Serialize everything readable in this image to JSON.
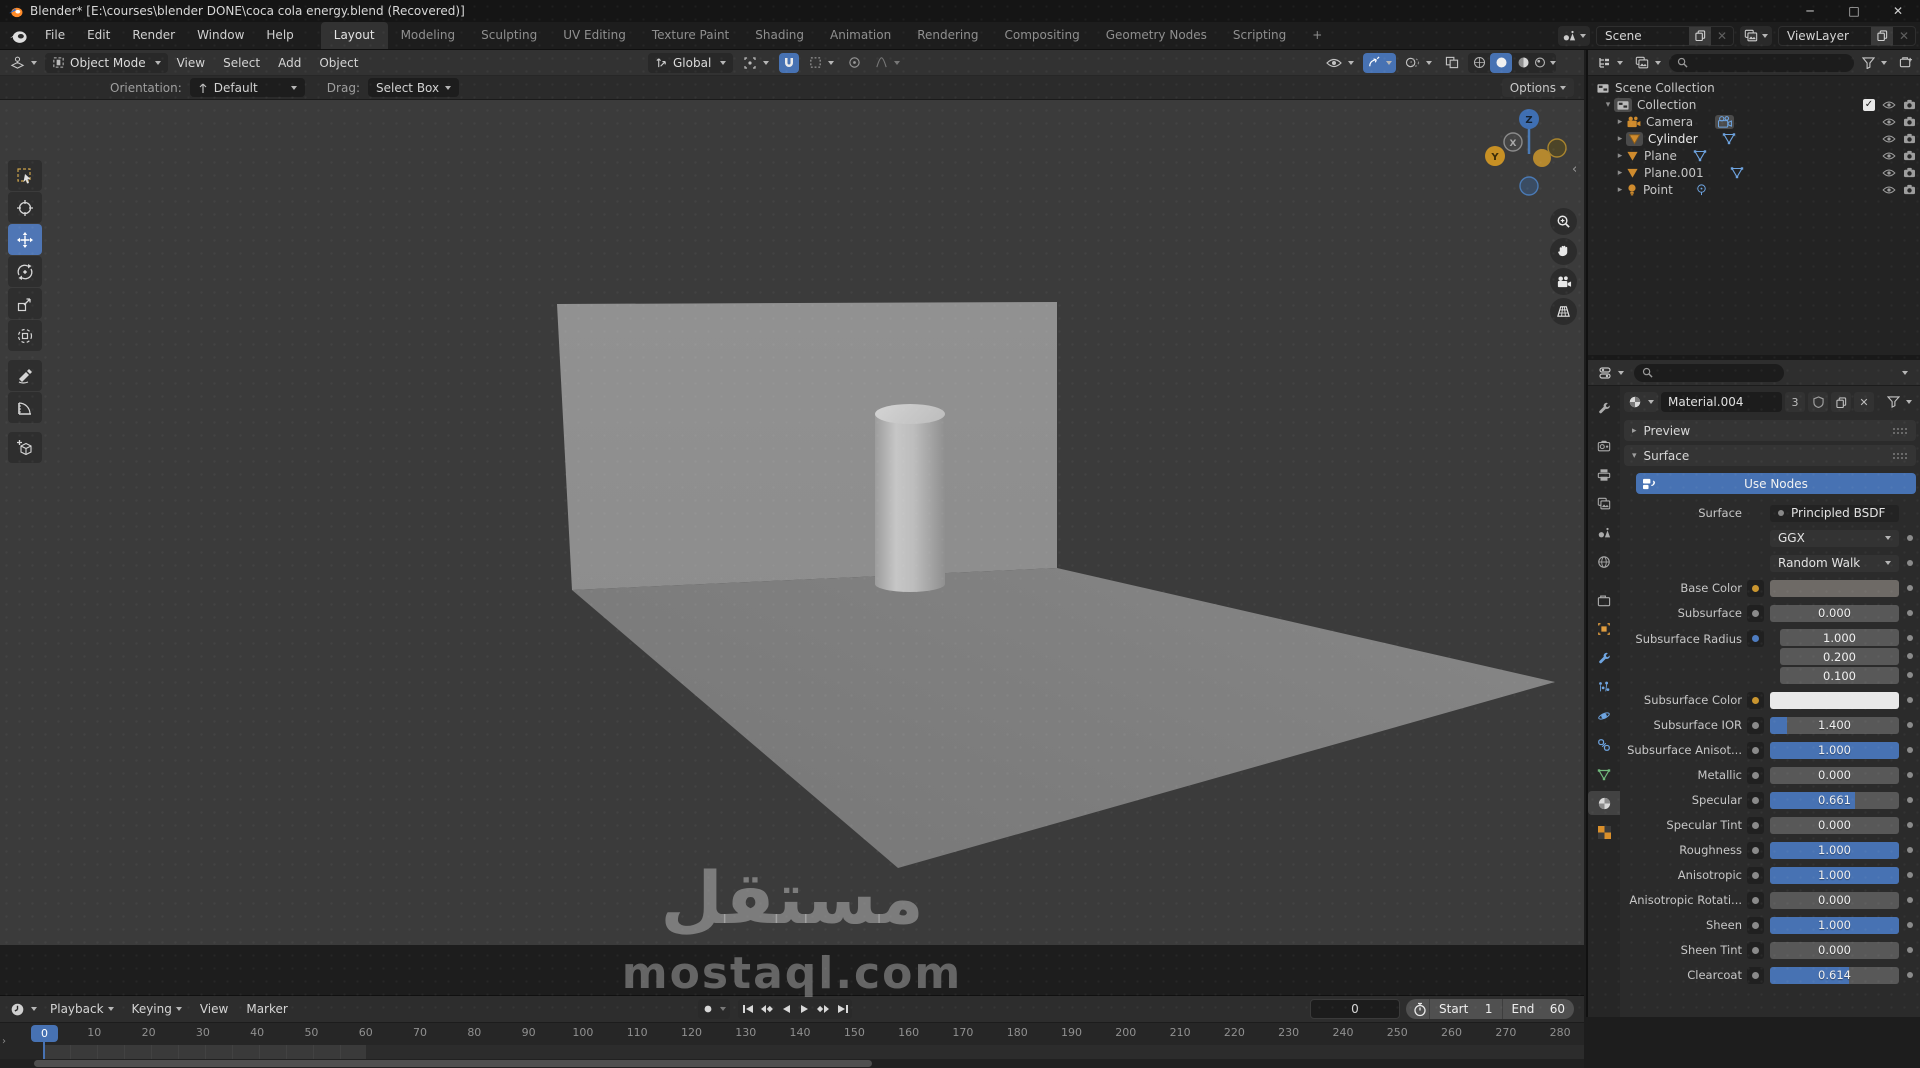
{
  "title_bar": {
    "title": "Blender* [E:\\courses\\blender DONE\\coca cola energy.blend (Recovered)]"
  },
  "window_controls": {
    "minimize": "─",
    "maximize": "□",
    "close": "✕"
  },
  "menu_bar": {
    "menus": [
      "File",
      "Edit",
      "Render",
      "Window",
      "Help"
    ],
    "tabs": [
      "Layout",
      "Modeling",
      "Sculpting",
      "UV Editing",
      "Texture Paint",
      "Shading",
      "Animation",
      "Rendering",
      "Compositing",
      "Geometry Nodes",
      "Scripting",
      "+"
    ],
    "active_tab": "Layout",
    "scene_name": "Scene",
    "view_layer_name": "ViewLayer"
  },
  "viewport_header": {
    "mode": "Object Mode",
    "menus": [
      "View",
      "Select",
      "Add",
      "Object"
    ],
    "orientation": "Global"
  },
  "tool_settings": {
    "orientation_label": "Orientation:",
    "orientation_value": "Default",
    "drag_label": "Drag:",
    "drag_value": "Select Box",
    "options_label": "Options"
  },
  "toolbar_tools": [
    "select-box",
    "cursor",
    "move",
    "rotate",
    "scale",
    "transform",
    "annotate",
    "measure",
    "add-cube"
  ],
  "active_tool": "move",
  "gizmo_axes": {
    "x": "X",
    "y": "Y",
    "z": "Z"
  },
  "outliner": {
    "rows": [
      {
        "name": "Scene Collection"
      },
      {
        "name": "Collection"
      },
      {
        "name": "Camera"
      },
      {
        "name": "Cylinder"
      },
      {
        "name": "Plane"
      },
      {
        "name": "Plane.001"
      },
      {
        "name": "Point"
      }
    ]
  },
  "properties": {
    "material_name": "Material.004",
    "users_count": "3",
    "preview_label": "Preview",
    "surface_panel_label": "Surface",
    "use_nodes_label": "Use Nodes",
    "surface_label": "Surface",
    "surface_value": "Principled BSDF",
    "distribution": "GGX",
    "sss_method": "Random Walk",
    "fields": [
      {
        "label": "Base Color",
        "kind": "color",
        "swatch": "#6e6a66"
      },
      {
        "label": "Subsurface",
        "value": "0.000",
        "fill": 0
      },
      {
        "label": "Subsurface Radius",
        "kind": "vector",
        "values": [
          "1.000",
          "0.200",
          "0.100"
        ]
      },
      {
        "label": "Subsurface Color",
        "kind": "color",
        "swatch": "#e9e9e9"
      },
      {
        "label": "Subsurface IOR",
        "value": "1.400",
        "fill": 0.13
      },
      {
        "label": "Subsurface Anisot...",
        "value": "1.000",
        "fill": 1
      },
      {
        "label": "Metallic",
        "value": "0.000",
        "fill": 0
      },
      {
        "label": "Specular",
        "value": "0.661",
        "fill": 0.66
      },
      {
        "label": "Specular Tint",
        "value": "0.000",
        "fill": 0
      },
      {
        "label": "Roughness",
        "value": "1.000",
        "fill": 1
      },
      {
        "label": "Anisotropic",
        "value": "1.000",
        "fill": 1
      },
      {
        "label": "Anisotropic Rotati...",
        "value": "0.000",
        "fill": 0
      },
      {
        "label": "Sheen",
        "value": "1.000",
        "fill": 1
      },
      {
        "label": "Sheen Tint",
        "value": "0.000",
        "fill": 0
      },
      {
        "label": "Clearcoat",
        "value": "0.614",
        "fill": 0.61
      }
    ]
  },
  "timeline": {
    "menus": [
      "Playback",
      "Keying",
      "View",
      "Marker"
    ],
    "current_frame": "0",
    "frame_field": "0",
    "start_label": "Start",
    "start_value": "1",
    "end_label": "End",
    "end_value": "60",
    "ticks": [
      "0",
      "10",
      "20",
      "30",
      "40",
      "50",
      "60",
      "70",
      "80",
      "90",
      "100",
      "110",
      "120",
      "130",
      "140",
      "150",
      "160",
      "170",
      "180",
      "190",
      "200",
      "210",
      "220",
      "230",
      "240",
      "250",
      "260",
      "270",
      "280"
    ]
  },
  "watermark": {
    "arabic": "مستقل",
    "latin": "mostaql.com"
  },
  "colors": {
    "accent_blue": "#4772b3",
    "selection_orange": "#cf8b2d",
    "viewport_bg": "#3b3b3b",
    "slider_track": "#585858"
  }
}
